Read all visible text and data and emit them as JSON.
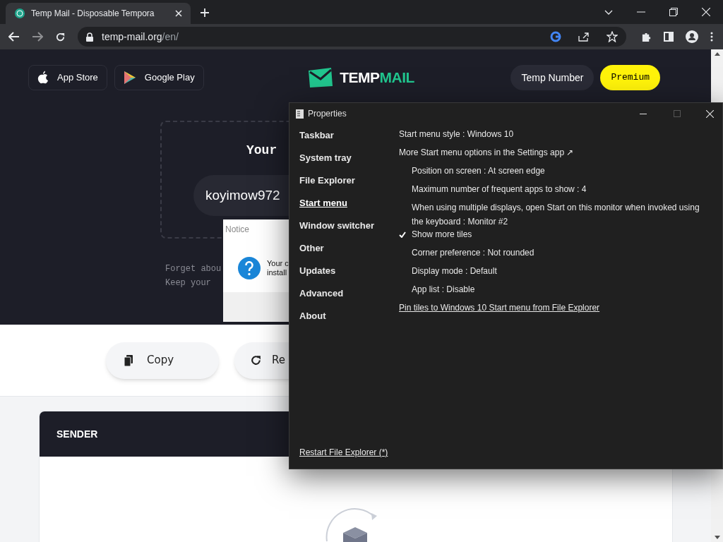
{
  "browser": {
    "tab_title": "Temp Mail - Disposable Tempora",
    "url_host": "temp-mail.org",
    "url_path": "/en/"
  },
  "site": {
    "store_buttons": [
      "App Store",
      "Google Play"
    ],
    "logo_parts": [
      "TEMP",
      "MAIL"
    ],
    "temp_number": "Temp Number",
    "premium": "Premium",
    "heading": "Your",
    "email": "koyimow972",
    "lines": [
      "Forget abou",
      "Keep your"
    ],
    "actions": [
      "Copy",
      "Re"
    ],
    "table_header": "SENDER"
  },
  "notice": {
    "title": "Notice",
    "lines": [
      "Your c",
      "install"
    ]
  },
  "properties": {
    "title": "Properties",
    "nav": [
      {
        "label": "Taskbar",
        "selected": false
      },
      {
        "label": "System tray",
        "selected": false
      },
      {
        "label": "File Explorer",
        "selected": false
      },
      {
        "label": "Start menu",
        "selected": true
      },
      {
        "label": "Window switcher",
        "selected": false
      },
      {
        "label": "Other",
        "selected": false
      },
      {
        "label": "Updates",
        "selected": false
      },
      {
        "label": "Advanced",
        "selected": false
      },
      {
        "label": "About",
        "selected": false
      }
    ],
    "settings": [
      {
        "kind": "value",
        "label": "Start menu style : Windows 10"
      },
      {
        "kind": "plain",
        "label": "More Start menu options in the Settings app ↗"
      },
      {
        "kind": "option",
        "label": "Position on screen : At screen edge",
        "checked": false
      },
      {
        "kind": "option",
        "label": "Maximum number of frequent apps to show : 4",
        "checked": false
      },
      {
        "kind": "option",
        "label": "When using multiple displays, open Start on this monitor when invoked using the keyboard : Monitor #2",
        "checked": false
      },
      {
        "kind": "option",
        "label": "Show more tiles",
        "checked": true
      },
      {
        "kind": "option",
        "label": "Corner preference : Not rounded",
        "checked": false
      },
      {
        "kind": "option",
        "label": "Display mode : Default",
        "checked": false
      },
      {
        "kind": "option",
        "label": "App list : Disable",
        "checked": false
      },
      {
        "kind": "link",
        "label": "Pin tiles to Windows 10 Start menu from File Explorer"
      }
    ],
    "footer_link": "Restart File Explorer (*)"
  }
}
